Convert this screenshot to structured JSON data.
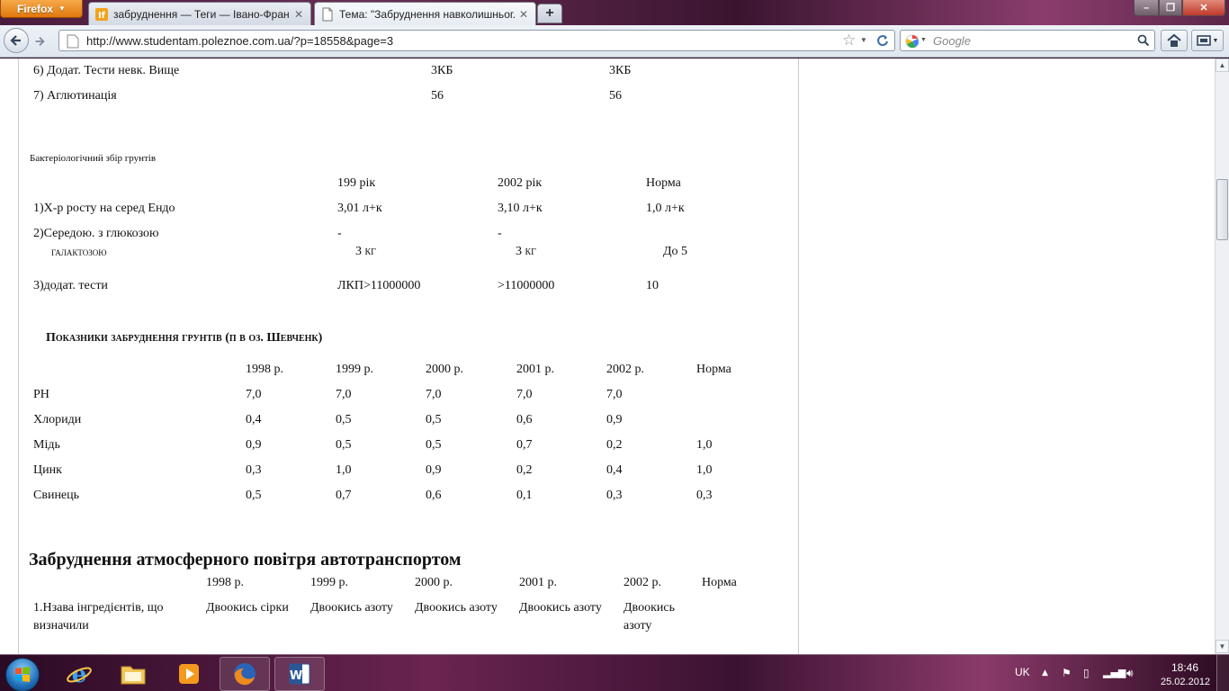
{
  "browser": {
    "menu_button": "Firefox",
    "tabs": [
      {
        "title": "забруднення — Теги — Івано-Фран...",
        "active": false
      },
      {
        "title": "Тема: \"Забруднення навколишньог...",
        "active": true
      }
    ],
    "new_tab_label": "+",
    "url": "http://www.studentam.poleznoe.com.ua/?p=18558&page=3",
    "search_placeholder": "Google",
    "window_controls": {
      "minimize": "–",
      "maximize": "❐",
      "close": "✕"
    }
  },
  "content": {
    "tests_table": {
      "rows": [
        {
          "label": "6) Додат. Тести невк. Вище",
          "v1": "3КБ",
          "v2": "3КБ"
        },
        {
          "label": "7) Аглютинація",
          "v1": "56",
          "v2": "56"
        }
      ]
    },
    "soil_section": {
      "caption": "Бактеріологічний збір грунтів",
      "headers": [
        "199 рік",
        "2002 рік",
        "Норма"
      ],
      "rows": [
        {
          "label": "1)Х-р росту на серед Ендо",
          "cells": [
            "3,01 л+к",
            "3,10 л+к",
            "1,0 л+к"
          ]
        },
        {
          "label": "2)Середою. з глюкозою",
          "cells": [
            "-",
            "-",
            ""
          ]
        },
        {
          "label": "галактозою",
          "cells": [
            "3 кг",
            "3 кг",
            "До 5"
          ]
        },
        {
          "label": "3)додат. тести",
          "cells": [
            "ЛКП>11000000",
            ">11000000",
            "10"
          ]
        }
      ]
    },
    "pollution_table": {
      "title": "Показники забруднення грунтів (п в оз. Шевченк)",
      "headers": [
        "1998 р.",
        "1999 р.",
        "2000 р.",
        "2001 р.",
        "2002 р.",
        "Норма"
      ],
      "rows": [
        {
          "label": "PH",
          "cells": [
            "7,0",
            "7,0",
            "7,0",
            "7,0",
            "7,0",
            ""
          ]
        },
        {
          "label": "Хлориди",
          "cells": [
            "0,4",
            "0,5",
            "0,5",
            "0,6",
            "0,9",
            ""
          ]
        },
        {
          "label": "Мідь",
          "cells": [
            "0,9",
            "0,5",
            "0,5",
            "0,7",
            "0,2",
            "1,0"
          ]
        },
        {
          "label": "Цинк",
          "cells": [
            "0,3",
            "1,0",
            "0,9",
            "0,2",
            "0,4",
            "1,0"
          ]
        },
        {
          "label": "Свинець",
          "cells": [
            "0,5",
            "0,7",
            "0,6",
            "0,1",
            "0,3",
            "0,3"
          ]
        }
      ]
    },
    "air_section": {
      "heading": "Забруднення атмосферного повітря автотранспортом",
      "headers": [
        "1998 р.",
        "1999 р.",
        "2000 р.",
        "2001 р.",
        "2002 р.",
        "Норма"
      ],
      "row_label_line1": "1.Нзава інгредієнтів, що",
      "row_label_line2": "визначили",
      "cells": [
        "Двоокись сірки",
        "Двоокись азоту",
        "Двоокись азоту",
        "Двоокись азоту",
        "Двоокись"
      ],
      "cell5_line2": "азоту"
    }
  },
  "taskbar": {
    "apps": [
      "internet-explorer",
      "windows-explorer",
      "media-player",
      "firefox",
      "word"
    ],
    "language": "UK",
    "time": "18:46",
    "date": "25.02.2012"
  }
}
